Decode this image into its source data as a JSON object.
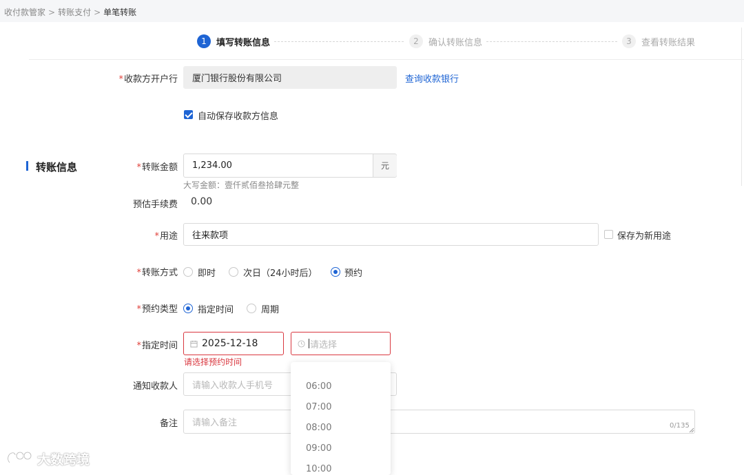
{
  "breadcrumb": {
    "items": [
      "收付款管家",
      "转账支付",
      "单笔转账"
    ],
    "separator": ">"
  },
  "steps": [
    {
      "num": "1",
      "label": "填写转账信息",
      "status": "active"
    },
    {
      "num": "2",
      "label": "确认转账信息",
      "status": "inactive"
    },
    {
      "num": "3",
      "label": "查看转账结果",
      "status": "inactive"
    }
  ],
  "payee": {
    "bank_label": "收款方开户行",
    "bank_value": "厦门银行股份有限公司",
    "bank_link": "查询收款银行",
    "autosave_label": "自动保存收款方信息",
    "autosave_checked": true
  },
  "transfer": {
    "section_title": "转账信息",
    "amount_label": "转账金额",
    "amount_value": "1,234.00",
    "amount_unit": "元",
    "amount_words": "大写金额：壹仟贰佰叁拾肆元整",
    "fee_label": "预估手续费",
    "fee_value": "0.00",
    "purpose_label": "用途",
    "purpose_value": "往来款项",
    "save_purpose_label": "保存为新用途",
    "method_label": "转账方式",
    "method_options": [
      "即时",
      "次日（24小时后）",
      "预约"
    ],
    "method_selected": "预约",
    "schedule_type_label": "预约类型",
    "schedule_type_options": [
      "指定时间",
      "周期"
    ],
    "schedule_type_selected": "指定时间",
    "time_label": "指定时间",
    "date_value": "2025-12-18",
    "time_placeholder": "请选择",
    "time_error": "请选择预约时间",
    "time_options": [
      "06:00",
      "07:00",
      "08:00",
      "09:00",
      "10:00"
    ],
    "notify_label": "通知收款人",
    "notify_placeholder": "请输入收款人手机号",
    "remark_label": "备注",
    "remark_placeholder": "请输入备注",
    "remark_counter": "0/135"
  },
  "watermark": "大数跨境",
  "colors": {
    "primary": "#1e64d4",
    "error": "#d9363e",
    "required": "#e0403a"
  }
}
